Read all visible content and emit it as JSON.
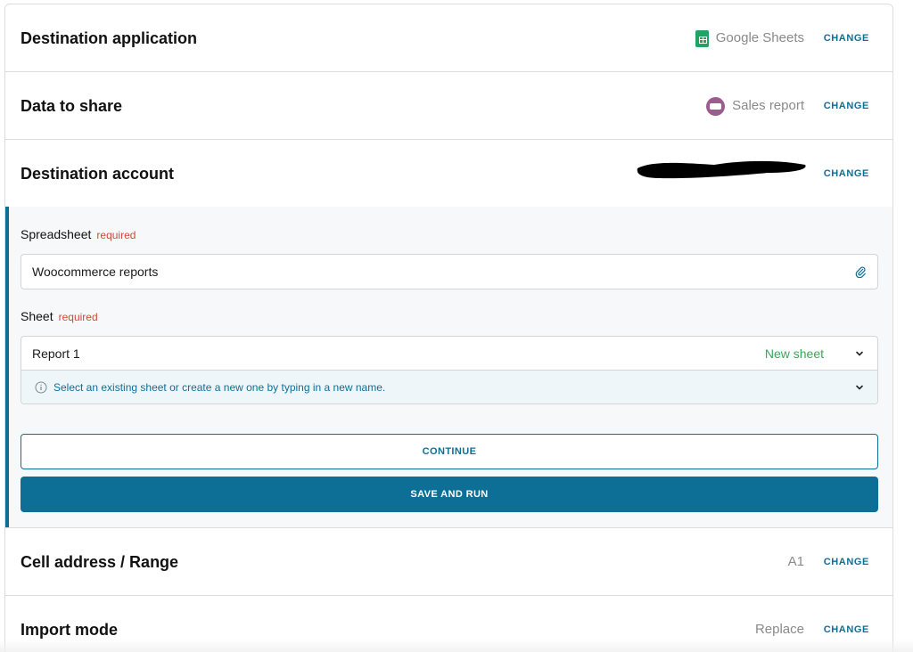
{
  "rows": {
    "destination_application": {
      "title": "Destination application",
      "value": "Google Sheets",
      "icon": "google-sheets-icon",
      "action": "CHANGE"
    },
    "data_to_share": {
      "title": "Data to share",
      "value": "Sales report",
      "icon": "woocommerce-icon",
      "action": "CHANGE"
    },
    "destination_account": {
      "title": "Destination account",
      "action": "CHANGE"
    },
    "cell_address": {
      "title": "Cell address / Range",
      "value": "A1",
      "action": "CHANGE"
    },
    "import_mode": {
      "title": "Import mode",
      "value": "Replace",
      "action": "CHANGE"
    }
  },
  "form": {
    "spreadsheet": {
      "label": "Spreadsheet",
      "required": "required",
      "value": "Woocommerce reports",
      "icon": "paperclip-icon"
    },
    "sheet": {
      "label": "Sheet",
      "required": "required",
      "value": "Report 1",
      "badge": "New sheet",
      "hint": "Select an existing sheet or create a new one by typing in a new name."
    },
    "continue_label": "CONTINUE",
    "save_run_label": "SAVE AND RUN"
  },
  "colors": {
    "accent": "#0e6f96",
    "required": "#d0493a",
    "new_sheet": "#3aa757",
    "google_sheets": "#1fa463",
    "woocommerce": "#9b5c8f"
  }
}
